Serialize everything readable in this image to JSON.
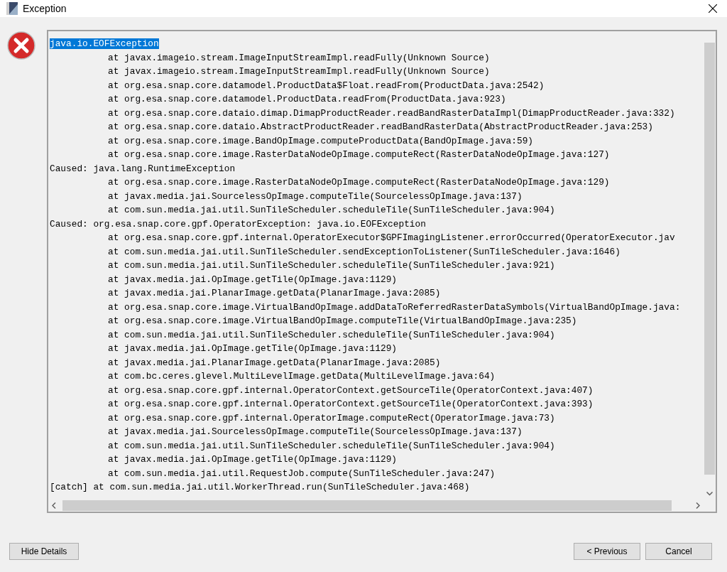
{
  "window": {
    "title": "Exception"
  },
  "trace": [
    {
      "kind": "head",
      "text": "java.io.EOFException",
      "selected": true
    },
    {
      "kind": "frame",
      "text": "at javax.imageio.stream.ImageInputStreamImpl.readFully(Unknown Source)",
      "selected": false
    },
    {
      "kind": "frame",
      "text": "at javax.imageio.stream.ImageInputStreamImpl.readFully(Unknown Source)",
      "selected": false
    },
    {
      "kind": "frame",
      "text": "at org.esa.snap.core.datamodel.ProductData$Float.readFrom(ProductData.java:2542)",
      "selected": false
    },
    {
      "kind": "frame",
      "text": "at org.esa.snap.core.datamodel.ProductData.readFrom(ProductData.java:923)",
      "selected": false
    },
    {
      "kind": "frame",
      "text": "at org.esa.snap.core.dataio.dimap.DimapProductReader.readBandRasterDataImpl(DimapProductReader.java:332)",
      "selected": false
    },
    {
      "kind": "frame",
      "text": "at org.esa.snap.core.dataio.AbstractProductReader.readBandRasterData(AbstractProductReader.java:253)",
      "selected": false
    },
    {
      "kind": "frame",
      "text": "at org.esa.snap.core.image.BandOpImage.computeProductData(BandOpImage.java:59)",
      "selected": false
    },
    {
      "kind": "frame",
      "text": "at org.esa.snap.core.image.RasterDataNodeOpImage.computeRect(RasterDataNodeOpImage.java:127)",
      "selected": false
    },
    {
      "kind": "head",
      "text": "Caused: java.lang.RuntimeException",
      "selected": false
    },
    {
      "kind": "frame",
      "text": "at org.esa.snap.core.image.RasterDataNodeOpImage.computeRect(RasterDataNodeOpImage.java:129)",
      "selected": false
    },
    {
      "kind": "frame",
      "text": "at javax.media.jai.SourcelessOpImage.computeTile(SourcelessOpImage.java:137)",
      "selected": false
    },
    {
      "kind": "frame",
      "text": "at com.sun.media.jai.util.SunTileScheduler.scheduleTile(SunTileScheduler.java:904)",
      "selected": false
    },
    {
      "kind": "head",
      "text": "Caused: org.esa.snap.core.gpf.OperatorException: java.io.EOFException",
      "selected": false
    },
    {
      "kind": "frame",
      "text": "at org.esa.snap.core.gpf.internal.OperatorExecutor$GPFImagingListener.errorOccurred(OperatorExecutor.jav",
      "selected": false
    },
    {
      "kind": "frame",
      "text": "at com.sun.media.jai.util.SunTileScheduler.sendExceptionToListener(SunTileScheduler.java:1646)",
      "selected": false
    },
    {
      "kind": "frame",
      "text": "at com.sun.media.jai.util.SunTileScheduler.scheduleTile(SunTileScheduler.java:921)",
      "selected": false
    },
    {
      "kind": "frame",
      "text": "at javax.media.jai.OpImage.getTile(OpImage.java:1129)",
      "selected": false
    },
    {
      "kind": "frame",
      "text": "at javax.media.jai.PlanarImage.getData(PlanarImage.java:2085)",
      "selected": false
    },
    {
      "kind": "frame",
      "text": "at org.esa.snap.core.image.VirtualBandOpImage.addDataToReferredRasterDataSymbols(VirtualBandOpImage.java:",
      "selected": false
    },
    {
      "kind": "frame",
      "text": "at org.esa.snap.core.image.VirtualBandOpImage.computeTile(VirtualBandOpImage.java:235)",
      "selected": false
    },
    {
      "kind": "frame",
      "text": "at com.sun.media.jai.util.SunTileScheduler.scheduleTile(SunTileScheduler.java:904)",
      "selected": false
    },
    {
      "kind": "frame",
      "text": "at javax.media.jai.OpImage.getTile(OpImage.java:1129)",
      "selected": false
    },
    {
      "kind": "frame",
      "text": "at javax.media.jai.PlanarImage.getData(PlanarImage.java:2085)",
      "selected": false
    },
    {
      "kind": "frame",
      "text": "at com.bc.ceres.glevel.MultiLevelImage.getData(MultiLevelImage.java:64)",
      "selected": false
    },
    {
      "kind": "frame",
      "text": "at org.esa.snap.core.gpf.internal.OperatorContext.getSourceTile(OperatorContext.java:407)",
      "selected": false
    },
    {
      "kind": "frame",
      "text": "at org.esa.snap.core.gpf.internal.OperatorContext.getSourceTile(OperatorContext.java:393)",
      "selected": false
    },
    {
      "kind": "frame",
      "text": "at org.esa.snap.core.gpf.internal.OperatorImage.computeRect(OperatorImage.java:73)",
      "selected": false
    },
    {
      "kind": "frame",
      "text": "at javax.media.jai.SourcelessOpImage.computeTile(SourcelessOpImage.java:137)",
      "selected": false
    },
    {
      "kind": "frame",
      "text": "at com.sun.media.jai.util.SunTileScheduler.scheduleTile(SunTileScheduler.java:904)",
      "selected": false
    },
    {
      "kind": "frame",
      "text": "at javax.media.jai.OpImage.getTile(OpImage.java:1129)",
      "selected": false
    },
    {
      "kind": "frame",
      "text": "at com.sun.media.jai.util.RequestJob.compute(SunTileScheduler.java:247)",
      "selected": false
    },
    {
      "kind": "head",
      "text": "[catch] at com.sun.media.jai.util.WorkerThread.run(SunTileScheduler.java:468)",
      "selected": false
    }
  ],
  "buttons_left": [
    "Hide Details"
  ],
  "buttons_right": [
    "< Previous",
    "Cancel"
  ]
}
